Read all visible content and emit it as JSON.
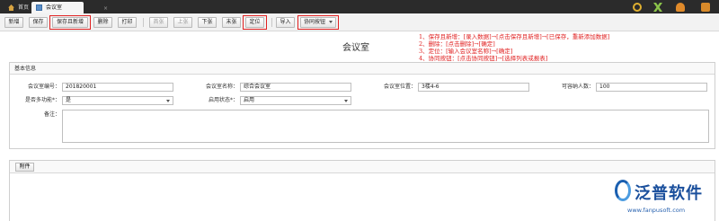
{
  "tabs": {
    "home": "首页",
    "active": "会议室",
    "close": "×"
  },
  "toolbar": {
    "add": "新增",
    "save": "保存",
    "save_new": "保存且新增",
    "delete": "删除",
    "print": "打印",
    "first": "首张",
    "prev": "上张",
    "next": "下张",
    "last": "末张",
    "locate": "定位",
    "import": "导入",
    "collab": "协同按钮"
  },
  "page_title": "会议室",
  "notes": [
    "1、保存且新增：[录入数据]→[点击保存且新增]→[已保存，重新添加数据]",
    "2、删除：[点击删除]→[确定]",
    "3、定位：[输入会议室名称]→[确定]",
    "4、协同按钮：[点击协同按钮]→[选择列表或报表]"
  ],
  "form": {
    "section": "基本信息",
    "room_no_label": "会议室编号：",
    "room_no": "201820001",
    "room_name_label": "会议室名称：",
    "room_name": "综合会议室",
    "location_label": "会议室位置：",
    "location": "3楼4-6",
    "capacity_label": "可容纳人数：",
    "capacity": "100",
    "multimedia_label": "是否多功能*：",
    "multimedia": "是",
    "status_label": "启用状态*：",
    "status": "启用",
    "remark_label": "备注："
  },
  "attachment": {
    "button": "附件"
  },
  "logo": {
    "name": "泛普软件",
    "url": "www.fanpusoft.com"
  },
  "colors": {
    "highlight": "#e02020",
    "brand": "#1a4f9c",
    "topbar": "#2b2b2b"
  }
}
